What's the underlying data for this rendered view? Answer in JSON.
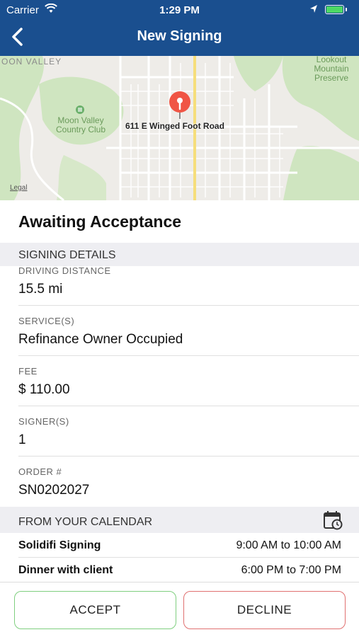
{
  "status_bar": {
    "carrier": "Carrier",
    "time": "1:29 PM",
    "battery_color": "#4cd964"
  },
  "nav": {
    "title": "New Signing",
    "back_icon": "chevron-left-icon",
    "background": "#1a4f8f"
  },
  "map": {
    "area_labels": [
      "OON VALLEY",
      "Lookout Mountain Preserve",
      "Moon Valley Country Club"
    ],
    "address": "611 E Winged Foot Road",
    "legal": "Legal",
    "pin_color": "#f05545"
  },
  "status_text": "Awaiting Acceptance",
  "signing_details": {
    "header": "SIGNING DETAILS",
    "driving_distance_label": "DRIVING DISTANCE",
    "driving_distance": "15.5 mi",
    "services_label": "SERVICE(S)",
    "services": "Refinance Owner Occupied",
    "fee_label": "FEE",
    "fee": "$ 110.00",
    "signers_label": "SIGNER(S)",
    "signers": "1",
    "order_label": "ORDER #",
    "order": "SN0202027"
  },
  "calendar": {
    "header": "FROM YOUR CALENDAR",
    "icon": "calendar-clock-icon",
    "events": [
      {
        "title": "Solidifi Signing",
        "time": "9:00 AM to 10:00 AM"
      },
      {
        "title": "Dinner with client",
        "time": "6:00 PM to 7:00 PM"
      }
    ]
  },
  "actions": {
    "accept": "ACCEPT",
    "decline": "DECLINE",
    "accept_color": "#7fcf7f",
    "decline_color": "#e07070"
  }
}
